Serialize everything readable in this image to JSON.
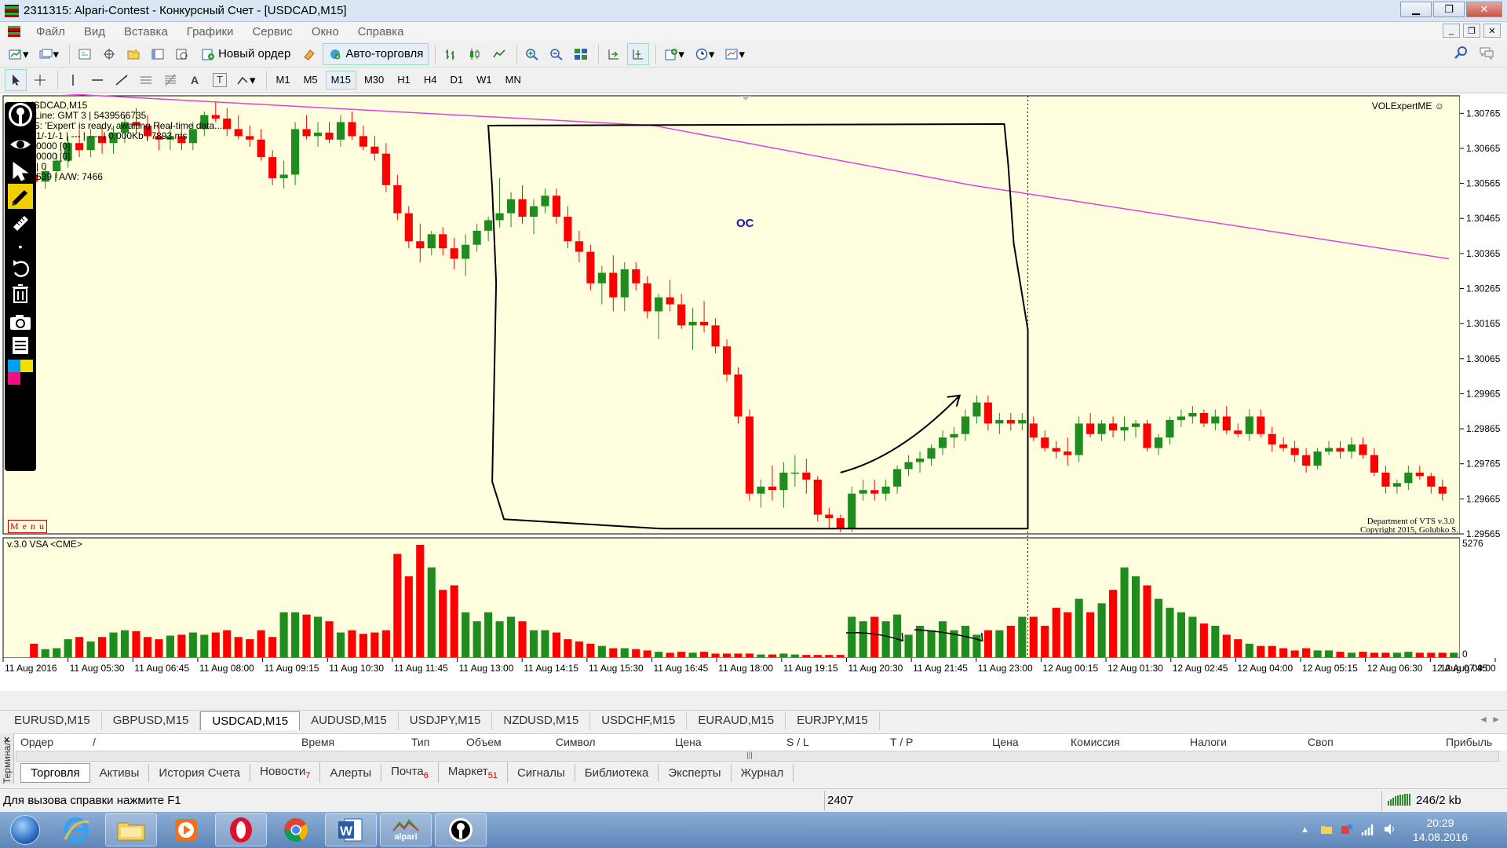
{
  "window": {
    "title": "2311315: Alpari-Contest - Конкурсный Счет - [USDCAD,M15]",
    "min": "▁",
    "max": "❐",
    "close": "✕"
  },
  "menu": [
    "Файл",
    "Вид",
    "Вставка",
    "Графики",
    "Сервис",
    "Окно",
    "Справка"
  ],
  "toolbar": {
    "new_order": "Новый ордер",
    "auto_trading": "Авто-торговля",
    "text_tool": "A",
    "label_tool": "T"
  },
  "timeframes": [
    "M1",
    "M5",
    "M15",
    "M30",
    "H1",
    "H4",
    "D1",
    "W1",
    "MN"
  ],
  "active_timeframe": "M15",
  "chart": {
    "symbol_label": "USDCAD,M15",
    "info_lines": [
      "e Line: GMT 3 | 5439566735",
      "US:  'Expert' is ready, awaiting Real-time data....",
      "-1/-1/-1 | --- | ---- | 0.000Kb | 7893 ms",
      "0000  [0]",
      "0000  [0]",
      "| 0",
      "539 | A/W: 7466"
    ],
    "indicator_name": "VOLExpertME",
    "annotation": "ОС",
    "menu_label": "M e n u",
    "copyright_1": "Department of VTS  v.3.0",
    "copyright_2": "Copyright 2015, Golubko S.",
    "price_ticks": [
      "1.30765",
      "1.30665",
      "1.30565",
      "1.30465",
      "1.30365",
      "1.30265",
      "1.30165",
      "1.30065",
      "1.29965",
      "1.29865",
      "1.29765",
      "1.29665",
      "1.29565"
    ],
    "volume_label": "v.3.0 VSA <CME>",
    "volume_max_label": "5276",
    "volume_zero_label": "0",
    "time_ticks": [
      "11 Aug 2016",
      "11 Aug 05:30",
      "11 Aug 06:45",
      "11 Aug 08:00",
      "11 Aug 09:15",
      "11 Aug 10:30",
      "11 Aug 11:45",
      "11 Aug 13:00",
      "11 Aug 14:15",
      "11 Aug 15:30",
      "11 Aug 16:45",
      "11 Aug 18:00",
      "11 Aug 19:15",
      "11 Aug 20:30",
      "11 Aug 21:45",
      "11 Aug 23:00",
      "12 Aug 00:15",
      "12 Aug 01:30",
      "12 Aug 02:45",
      "12 Aug 04:00",
      "12 Aug 05:15",
      "12 Aug 06:30",
      "12 Aug 07:45",
      "12 Aug 09:00"
    ],
    "colors": {
      "bg": "#ffffe0",
      "bull": "#1e8c1e",
      "bear": "#ff0000",
      "ma": "#e040e0"
    }
  },
  "chart_data": {
    "type": "candlestick",
    "symbol": "USDCAD",
    "timeframe": "M15",
    "ylim": [
      1.29565,
      1.30815
    ],
    "candles": [
      [
        1.3059,
        1.3062,
        1.3056,
        1.3057
      ],
      [
        1.3057,
        1.3061,
        1.3055,
        1.306
      ],
      [
        1.306,
        1.3065,
        1.3058,
        1.3063
      ],
      [
        1.3063,
        1.307,
        1.3061,
        1.3068
      ],
      [
        1.3068,
        1.3072,
        1.3064,
        1.3066
      ],
      [
        1.3066,
        1.3072,
        1.3064,
        1.307
      ],
      [
        1.307,
        1.3073,
        1.3065,
        1.3068
      ],
      [
        1.3068,
        1.3073,
        1.3065,
        1.3071
      ],
      [
        1.3071,
        1.3076,
        1.3068,
        1.3074
      ],
      [
        1.3074,
        1.3078,
        1.3071,
        1.3073
      ],
      [
        1.3073,
        1.3076,
        1.3069,
        1.307
      ],
      [
        1.307,
        1.3074,
        1.3066,
        1.3069
      ],
      [
        1.3069,
        1.3073,
        1.3066,
        1.307
      ],
      [
        1.307,
        1.3072,
        1.3066,
        1.3068
      ],
      [
        1.3068,
        1.3074,
        1.3066,
        1.3072
      ],
      [
        1.3072,
        1.3077,
        1.307,
        1.3076
      ],
      [
        1.3076,
        1.308,
        1.3074,
        1.3075
      ],
      [
        1.3075,
        1.3078,
        1.307,
        1.3072
      ],
      [
        1.3072,
        1.3076,
        1.3069,
        1.307
      ],
      [
        1.307,
        1.3073,
        1.3067,
        1.3069
      ],
      [
        1.3069,
        1.3072,
        1.3063,
        1.3064
      ],
      [
        1.3064,
        1.3066,
        1.3056,
        1.3058
      ],
      [
        1.3058,
        1.3063,
        1.3055,
        1.3059
      ],
      [
        1.3059,
        1.3074,
        1.3056,
        1.3072
      ],
      [
        1.3072,
        1.3076,
        1.3069,
        1.307
      ],
      [
        1.307,
        1.3074,
        1.3067,
        1.3071
      ],
      [
        1.3071,
        1.3074,
        1.3068,
        1.3069
      ],
      [
        1.3069,
        1.3076,
        1.3067,
        1.3074
      ],
      [
        1.3074,
        1.3077,
        1.3069,
        1.307
      ],
      [
        1.307,
        1.3073,
        1.3066,
        1.3067
      ],
      [
        1.3067,
        1.307,
        1.3063,
        1.3065
      ],
      [
        1.3065,
        1.3068,
        1.3054,
        1.3056
      ],
      [
        1.3056,
        1.3059,
        1.3046,
        1.3048
      ],
      [
        1.3048,
        1.305,
        1.3038,
        1.304
      ],
      [
        1.304,
        1.3045,
        1.3034,
        1.3038
      ],
      [
        1.3038,
        1.3043,
        1.3036,
        1.3042
      ],
      [
        1.3042,
        1.3044,
        1.3036,
        1.3038
      ],
      [
        1.3038,
        1.3041,
        1.3032,
        1.3035
      ],
      [
        1.3035,
        1.3042,
        1.303,
        1.3039
      ],
      [
        1.3039,
        1.3045,
        1.3037,
        1.3043
      ],
      [
        1.3043,
        1.3047,
        1.304,
        1.3046
      ],
      [
        1.3046,
        1.3058,
        1.3044,
        1.3048
      ],
      [
        1.3048,
        1.3054,
        1.3044,
        1.3052
      ],
      [
        1.3052,
        1.3056,
        1.3045,
        1.3047
      ],
      [
        1.3047,
        1.3052,
        1.3042,
        1.305
      ],
      [
        1.305,
        1.3055,
        1.3048,
        1.3053
      ],
      [
        1.3053,
        1.3055,
        1.3045,
        1.3047
      ],
      [
        1.3047,
        1.305,
        1.3038,
        1.304
      ],
      [
        1.304,
        1.3043,
        1.3034,
        1.3037
      ],
      [
        1.3037,
        1.3039,
        1.3026,
        1.3028
      ],
      [
        1.3028,
        1.3033,
        1.3022,
        1.3031
      ],
      [
        1.3031,
        1.3036,
        1.302,
        1.3024
      ],
      [
        1.3024,
        1.3034,
        1.302,
        1.3032
      ],
      [
        1.3032,
        1.3034,
        1.3026,
        1.3028
      ],
      [
        1.3028,
        1.303,
        1.3018,
        1.302
      ],
      [
        1.302,
        1.3025,
        1.3012,
        1.3024
      ],
      [
        1.3024,
        1.3029,
        1.302,
        1.3022
      ],
      [
        1.3022,
        1.3025,
        1.3015,
        1.3016
      ],
      [
        1.3016,
        1.3021,
        1.3009,
        1.3017
      ],
      [
        1.3017,
        1.3023,
        1.3014,
        1.3016
      ],
      [
        1.3016,
        1.3018,
        1.3008,
        1.301
      ],
      [
        1.301,
        1.3012,
        1.3,
        1.3002
      ],
      [
        1.3002,
        1.3004,
        1.2988,
        1.299
      ],
      [
        1.299,
        1.2992,
        1.2966,
        1.2968
      ],
      [
        1.2968,
        1.2972,
        1.2964,
        1.297
      ],
      [
        1.297,
        1.2976,
        1.2966,
        1.2969
      ],
      [
        1.2969,
        1.2977,
        1.2964,
        1.2974
      ],
      [
        1.2974,
        1.2979,
        1.297,
        1.2974
      ],
      [
        1.2974,
        1.2978,
        1.2968,
        1.2972
      ],
      [
        1.2972,
        1.2973,
        1.296,
        1.2962
      ],
      [
        1.2962,
        1.2964,
        1.2958,
        1.2961
      ],
      [
        1.2961,
        1.2962,
        1.2957,
        1.2958
      ],
      [
        1.2958,
        1.297,
        1.2957,
        1.2968
      ],
      [
        1.2968,
        1.2972,
        1.2966,
        1.2969
      ],
      [
        1.2969,
        1.2972,
        1.2966,
        1.2968
      ],
      [
        1.2968,
        1.2972,
        1.2966,
        1.297
      ],
      [
        1.297,
        1.2976,
        1.2968,
        1.2975
      ],
      [
        1.2975,
        1.2979,
        1.2973,
        1.2977
      ],
      [
        1.2977,
        1.298,
        1.2974,
        1.2978
      ],
      [
        1.2978,
        1.2982,
        1.2976,
        1.2981
      ],
      [
        1.2981,
        1.2986,
        1.2979,
        1.2984
      ],
      [
        1.2984,
        1.2987,
        1.2981,
        1.2985
      ],
      [
        1.2985,
        1.2992,
        1.2983,
        1.299
      ],
      [
        1.299,
        1.2996,
        1.2988,
        1.2994
      ],
      [
        1.2994,
        1.2996,
        1.2986,
        1.2988
      ],
      [
        1.2988,
        1.2991,
        1.2985,
        1.2989
      ],
      [
        1.2989,
        1.2991,
        1.2986,
        1.2988
      ],
      [
        1.2988,
        1.2991,
        1.2986,
        1.2989
      ],
      [
        1.2988,
        1.299,
        1.2983,
        1.2984
      ],
      [
        1.2984,
        1.2986,
        1.298,
        1.2981
      ],
      [
        1.2981,
        1.2983,
        1.2978,
        1.298
      ],
      [
        1.298,
        1.2984,
        1.2976,
        1.2979
      ],
      [
        1.2979,
        1.299,
        1.2977,
        1.2988
      ],
      [
        1.2988,
        1.2991,
        1.2984,
        1.2985
      ],
      [
        1.2985,
        1.2989,
        1.2983,
        1.2988
      ],
      [
        1.2988,
        1.299,
        1.2984,
        1.2986
      ],
      [
        1.2986,
        1.299,
        1.2983,
        1.2987
      ],
      [
        1.2987,
        1.2989,
        1.2984,
        1.2988
      ],
      [
        1.2988,
        1.2989,
        1.298,
        1.2981
      ],
      [
        1.2981,
        1.2985,
        1.2979,
        1.2984
      ],
      [
        1.2984,
        1.299,
        1.2982,
        1.2989
      ],
      [
        1.2989,
        1.2992,
        1.2987,
        1.299
      ],
      [
        1.299,
        1.2993,
        1.2988,
        1.2991
      ],
      [
        1.2991,
        1.2992,
        1.2987,
        1.2988
      ],
      [
        1.2988,
        1.2992,
        1.2986,
        1.299
      ],
      [
        1.299,
        1.2993,
        1.2985,
        1.2986
      ],
      [
        1.2986,
        1.2988,
        1.2984,
        1.2985
      ],
      [
        1.2985,
        1.2992,
        1.2983,
        1.299
      ],
      [
        1.299,
        1.2992,
        1.2984,
        1.2985
      ],
      [
        1.2985,
        1.2987,
        1.298,
        1.2982
      ],
      [
        1.2982,
        1.2984,
        1.298,
        1.2981
      ],
      [
        1.2981,
        1.2983,
        1.2977,
        1.2979
      ],
      [
        1.2979,
        1.2981,
        1.2974,
        1.2976
      ],
      [
        1.2976,
        1.2981,
        1.2975,
        1.298
      ],
      [
        1.298,
        1.2983,
        1.2979,
        1.2981
      ],
      [
        1.2981,
        1.2983,
        1.2978,
        1.298
      ],
      [
        1.298,
        1.2984,
        1.2978,
        1.2982
      ],
      [
        1.2982,
        1.2984,
        1.2978,
        1.2979
      ],
      [
        1.2979,
        1.2981,
        1.2973,
        1.2974
      ],
      [
        1.2974,
        1.2976,
        1.2968,
        1.297
      ],
      [
        1.297,
        1.2972,
        1.2968,
        1.2971
      ],
      [
        1.2971,
        1.2976,
        1.2969,
        1.2974
      ],
      [
        1.2974,
        1.2976,
        1.2972,
        1.2973
      ],
      [
        1.2973,
        1.2974,
        1.2968,
        1.297
      ],
      [
        1.297,
        1.2972,
        1.2966,
        1.2968
      ]
    ],
    "volume": [
      30,
      18,
      20,
      40,
      45,
      35,
      45,
      55,
      60,
      58,
      45,
      40,
      48,
      50,
      55,
      50,
      55,
      60,
      45,
      40,
      60,
      45,
      100,
      100,
      95,
      90,
      80,
      55,
      60,
      52,
      55,
      60,
      230,
      180,
      250,
      200,
      150,
      160,
      100,
      80,
      100,
      80,
      90,
      80,
      60,
      60,
      55,
      40,
      35,
      30,
      25,
      20,
      20,
      18,
      15,
      12,
      10,
      12,
      10,
      12,
      8,
      8,
      8,
      8,
      6,
      6,
      8,
      6,
      5,
      5,
      5,
      5,
      90,
      80,
      90,
      80,
      95,
      50,
      70,
      60,
      80,
      60,
      70,
      50,
      60,
      60,
      70,
      90,
      90,
      70,
      110,
      100,
      130,
      100,
      120,
      150,
      200,
      180,
      160,
      130,
      110,
      100,
      90,
      75,
      70,
      50,
      40,
      30,
      25,
      25,
      20,
      15,
      20,
      15,
      15,
      12,
      10,
      12,
      10,
      10,
      10,
      12,
      10,
      10,
      10,
      10
    ],
    "ma_line": [
      [
        1.3083,
        0
      ],
      [
        1.3073,
        0.45
      ],
      [
        1.3056,
        0.67
      ],
      [
        1.3035,
        1.0
      ]
    ],
    "rectangle_annotation": "ОС"
  },
  "symbol_tabs": [
    "EURUSD,M15",
    "GBPUSD,M15",
    "USDCAD,M15",
    "AUDUSD,M15",
    "USDJPY,M15",
    "NZDUSD,M15",
    "USDCHF,M15",
    "EURAUD,M15",
    "EURJPY,M15"
  ],
  "active_symbol_tab": "USDCAD,M15",
  "terminal": {
    "side_label": "Терминал",
    "columns": [
      "Ордер",
      "/",
      "Время",
      "Тип",
      "Объем",
      "Символ",
      "Цена",
      "S / L",
      "T / P",
      "Цена",
      "Комиссия",
      "Налоги",
      "Своп",
      "Прибыль"
    ],
    "tabs": [
      {
        "label": "Торговля",
        "badge": ""
      },
      {
        "label": "Активы",
        "badge": ""
      },
      {
        "label": "История Счета",
        "badge": ""
      },
      {
        "label": "Новости",
        "badge": "7"
      },
      {
        "label": "Алерты",
        "badge": ""
      },
      {
        "label": "Почта",
        "badge": "6"
      },
      {
        "label": "Маркет",
        "badge": "51"
      },
      {
        "label": "Сигналы",
        "badge": ""
      },
      {
        "label": "Библиотека",
        "badge": ""
      },
      {
        "label": "Эксперты",
        "badge": ""
      },
      {
        "label": "Журнал",
        "badge": ""
      }
    ],
    "active_tab": "Торговля"
  },
  "status": {
    "help": "Для вызова справки нажмите F1",
    "code": "2407",
    "traffic": "246/2 kb"
  },
  "taskbar": {
    "apps": [
      "ie-icon",
      "explorer-icon",
      "media-player-icon",
      "opera-icon",
      "chrome-icon",
      "word-icon",
      "alpari-icon",
      "expert-icon"
    ],
    "alpari_label": "alpari",
    "time": "20:29",
    "date": "14.08.2016"
  }
}
